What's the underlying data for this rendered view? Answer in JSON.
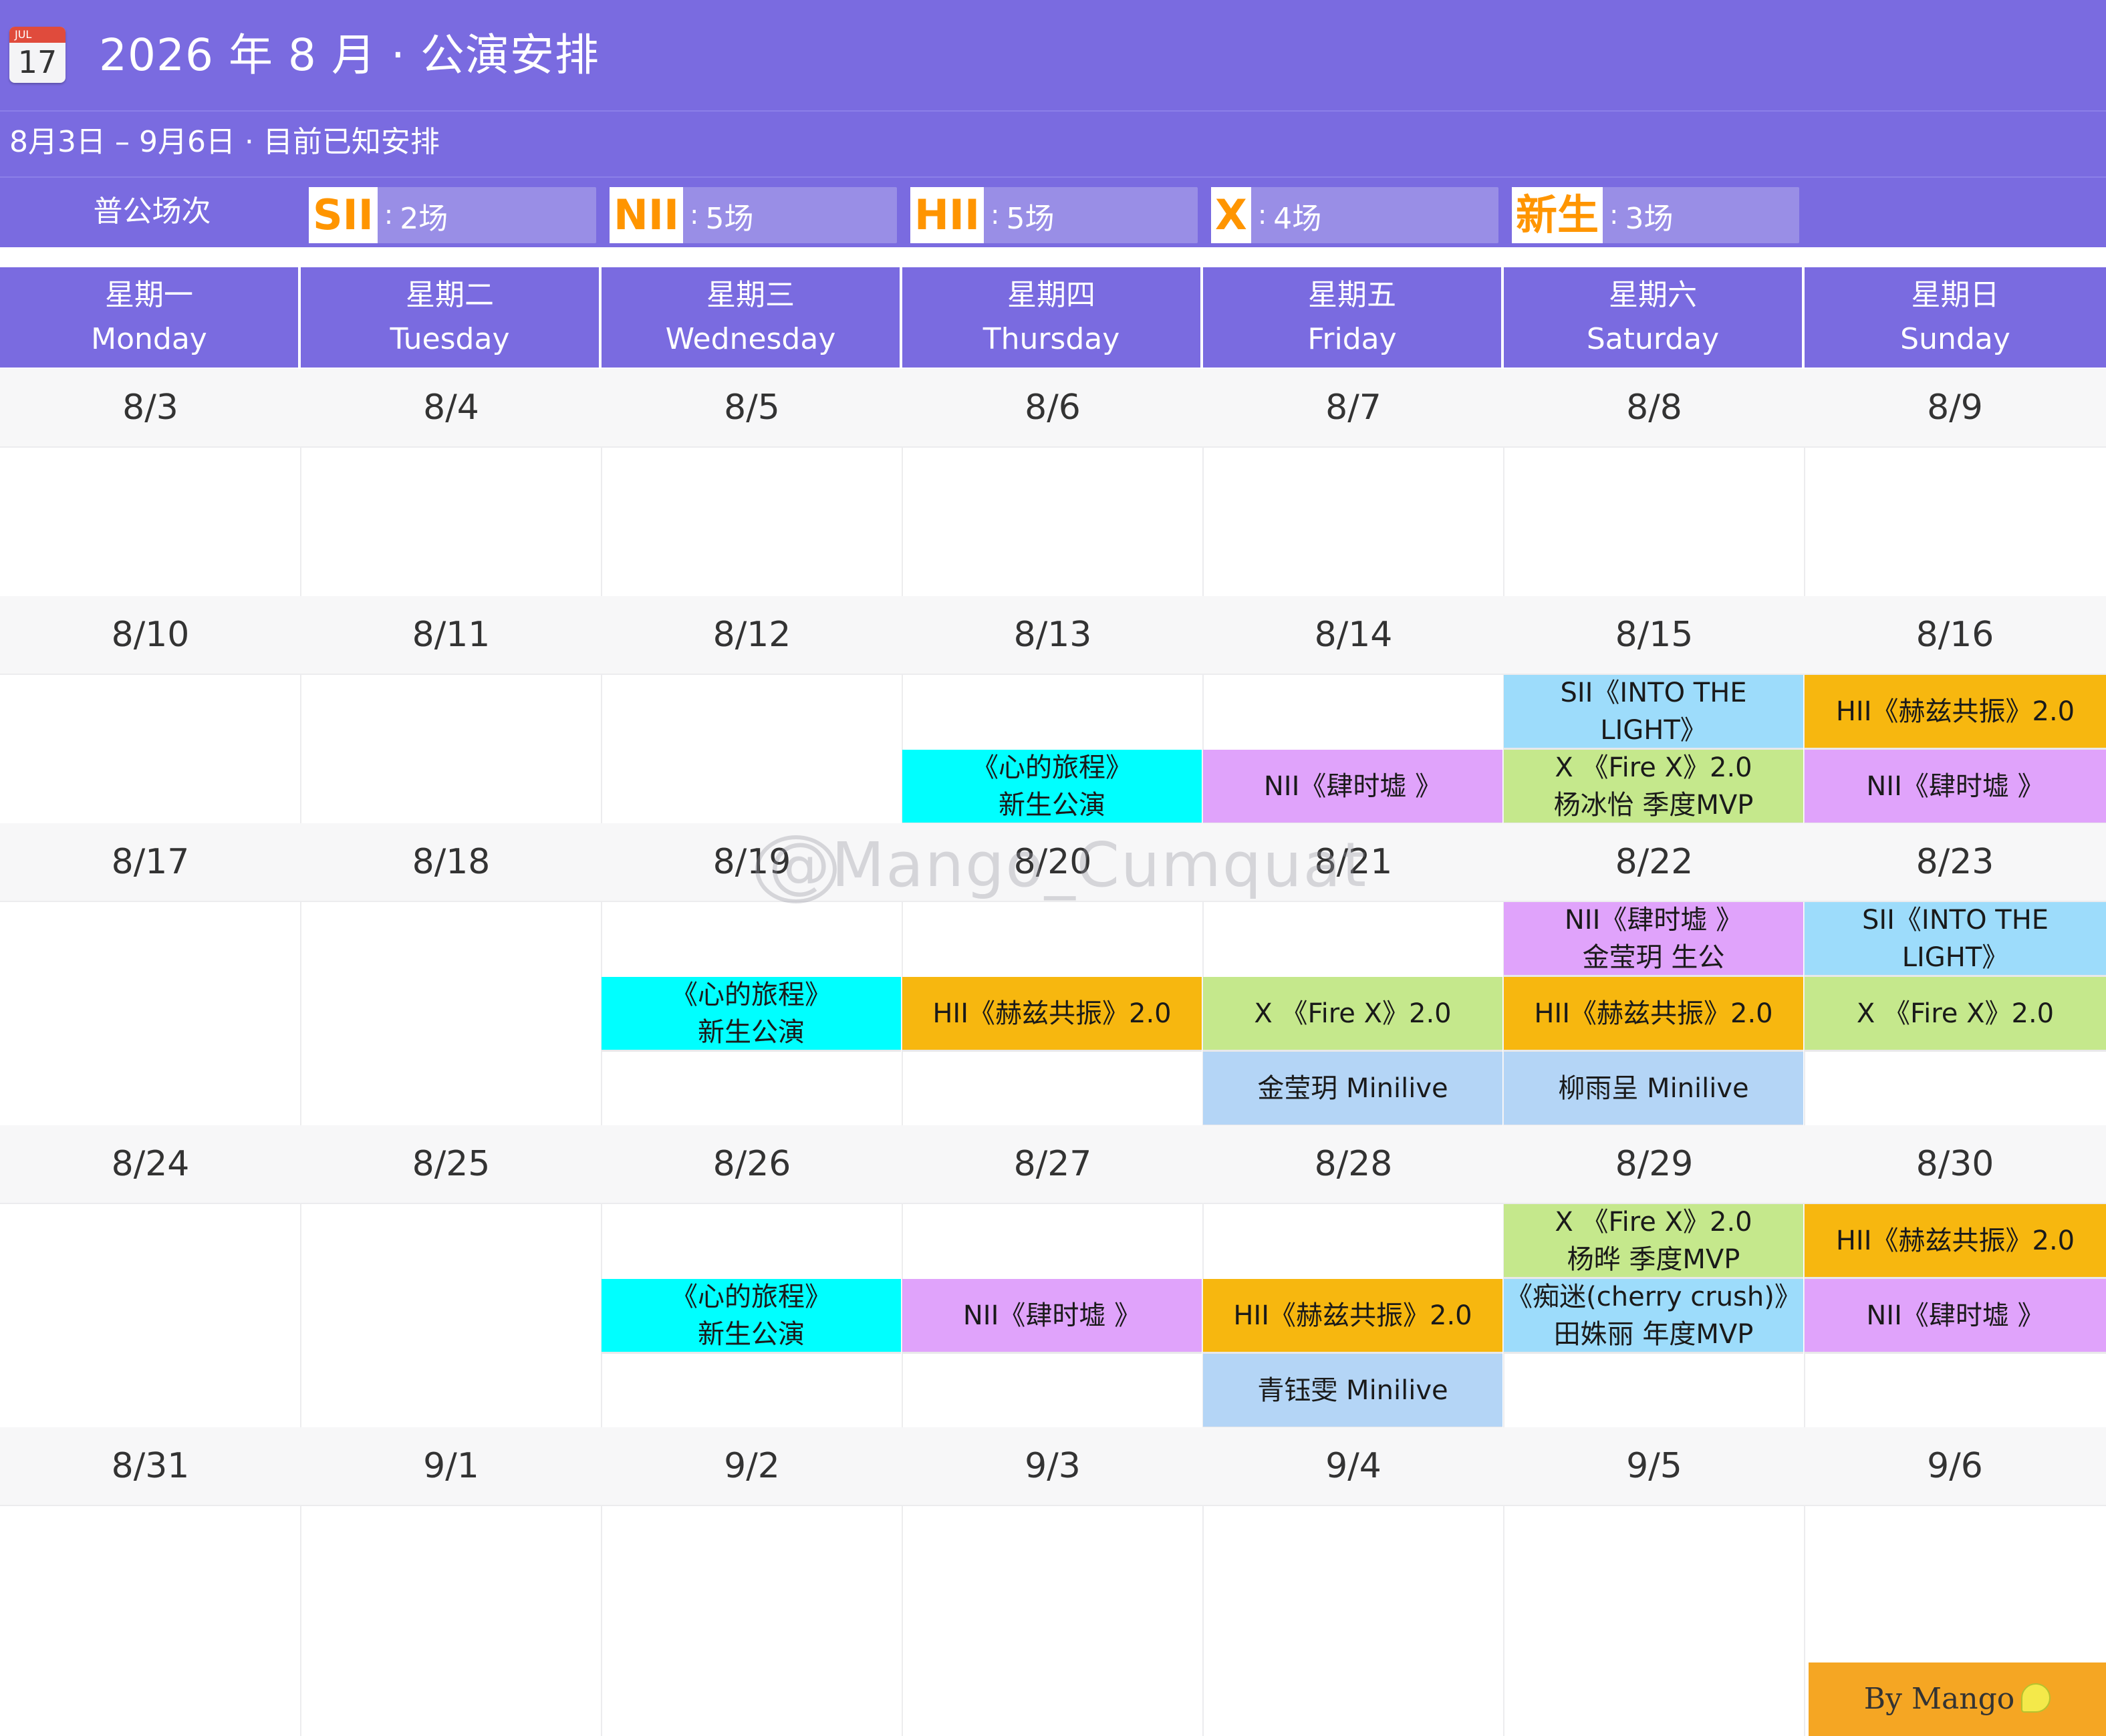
{
  "header": {
    "icon_month": "JUL",
    "icon_day": "17",
    "title": "2026 年 8 月 · 公演安排",
    "subtitle": "8月3日 – 9月6日 · 目前已知安排",
    "counts_label": "普公场次",
    "counts": [
      {
        "team": "SII",
        "sep": ":",
        "value": "2场"
      },
      {
        "team": "NII",
        "sep": ":",
        "value": "5场"
      },
      {
        "team": "HII",
        "sep": ":",
        "value": "5场"
      },
      {
        "team": "X",
        "sep": ":",
        "value": "4场"
      },
      {
        "team": "新生",
        "sep": ":",
        "value": "3场"
      }
    ]
  },
  "weekdays": [
    {
      "zh": "星期一",
      "en": "Monday"
    },
    {
      "zh": "星期二",
      "en": "Tuesday"
    },
    {
      "zh": "星期三",
      "en": "Wednesday"
    },
    {
      "zh": "星期四",
      "en": "Thursday"
    },
    {
      "zh": "星期五",
      "en": "Friday"
    },
    {
      "zh": "星期六",
      "en": "Saturday"
    },
    {
      "zh": "星期日",
      "en": "Sunday"
    }
  ],
  "weeks": [
    {
      "dates": [
        "8/3",
        "8/4",
        "8/5",
        "8/6",
        "8/7",
        "8/8",
        "8/9"
      ],
      "events": []
    },
    {
      "dates": [
        "8/10",
        "8/11",
        "8/12",
        "8/13",
        "8/14",
        "8/15",
        "8/16"
      ],
      "events": [
        {
          "day": 5,
          "slot": 0,
          "text": "SII《INTO THE\nLIGHT》",
          "color": "#9ddcfb"
        },
        {
          "day": 6,
          "slot": 0,
          "text": "HII《赫兹共振》2.0",
          "color": "#f7b70f"
        },
        {
          "day": 3,
          "slot": 1,
          "text": "《心的旅程》\n新生公演",
          "color": "#00ffff"
        },
        {
          "day": 4,
          "slot": 1,
          "text": "NII《肆时墟 》",
          "color": "#e0a3fb"
        },
        {
          "day": 5,
          "slot": 1,
          "text": "X 《Fire X》2.0\n杨冰怡 季度MVP",
          "color": "#c5e88c"
        },
        {
          "day": 6,
          "slot": 1,
          "text": "NII《肆时墟 》",
          "color": "#e0a3fb"
        }
      ]
    },
    {
      "dates": [
        "8/17",
        "8/18",
        "8/19",
        "8/20",
        "8/21",
        "8/22",
        "8/23"
      ],
      "events": [
        {
          "day": 5,
          "slot": 0,
          "text": "NII《肆时墟 》\n金莹玥 生公",
          "color": "#e0a3fb"
        },
        {
          "day": 6,
          "slot": 0,
          "text": "SII《INTO THE\nLIGHT》",
          "color": "#9ddcfb"
        },
        {
          "day": 2,
          "slot": 1,
          "text": "《心的旅程》\n新生公演",
          "color": "#00ffff"
        },
        {
          "day": 3,
          "slot": 1,
          "text": "HII《赫兹共振》2.0",
          "color": "#f7b70f"
        },
        {
          "day": 4,
          "slot": 1,
          "text": "X 《Fire X》2.0",
          "color": "#c5e88c"
        },
        {
          "day": 5,
          "slot": 1,
          "text": "HII《赫兹共振》2.0",
          "color": "#f7b70f"
        },
        {
          "day": 6,
          "slot": 1,
          "text": "X 《Fire X》2.0",
          "color": "#c5e88c"
        },
        {
          "day": 4,
          "slot": 2,
          "text": "金莹玥 Minilive",
          "color": "#b4d5f6"
        },
        {
          "day": 5,
          "slot": 2,
          "text": "柳雨呈 Minilive",
          "color": "#b4d5f6"
        }
      ]
    },
    {
      "dates": [
        "8/24",
        "8/25",
        "8/26",
        "8/27",
        "8/28",
        "8/29",
        "8/30"
      ],
      "events": [
        {
          "day": 5,
          "slot": 0,
          "text": "X 《Fire X》2.0\n杨晔 季度MVP",
          "color": "#c5e88c"
        },
        {
          "day": 6,
          "slot": 0,
          "text": "HII《赫兹共振》2.0",
          "color": "#f7b70f"
        },
        {
          "day": 2,
          "slot": 1,
          "text": "《心的旅程》\n新生公演",
          "color": "#00ffff"
        },
        {
          "day": 3,
          "slot": 1,
          "text": "NII《肆时墟 》",
          "color": "#e0a3fb"
        },
        {
          "day": 4,
          "slot": 1,
          "text": "HII《赫兹共振》2.0",
          "color": "#f7b70f"
        },
        {
          "day": 5,
          "slot": 1,
          "text": "《痴迷(cherry crush)》\n田姝丽 年度MVP",
          "color": "#9ddcfb"
        },
        {
          "day": 6,
          "slot": 1,
          "text": "NII《肆时墟 》",
          "color": "#e0a3fb"
        },
        {
          "day": 4,
          "slot": 2,
          "text": "青钰雯 Minilive",
          "color": "#b4d5f6"
        }
      ]
    },
    {
      "dates": [
        "8/31",
        "9/1",
        "9/2",
        "9/3",
        "9/4",
        "9/5",
        "9/6"
      ],
      "events": []
    }
  ],
  "watermark": "@Mango_Cumquat",
  "credit": "By Mango"
}
